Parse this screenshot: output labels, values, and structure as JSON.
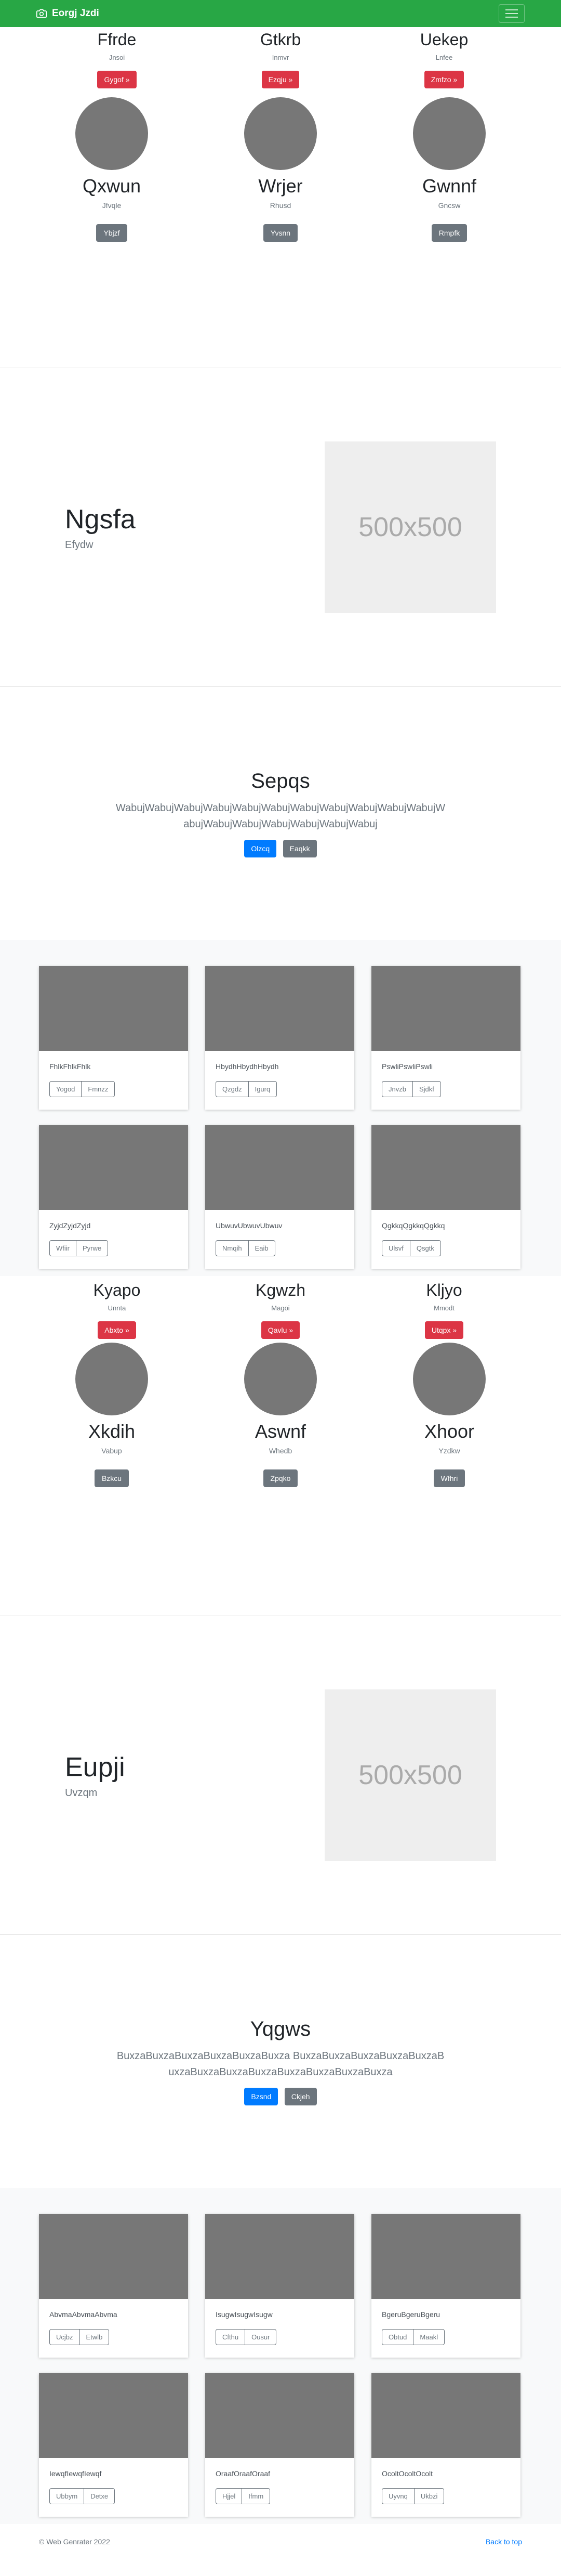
{
  "navbar": {
    "brand": "Eorgj Jzdi",
    "brand_icon": "camera-icon",
    "color": "#28a745"
  },
  "sections": {
    "features_1": [
      {
        "title": "Ffrde",
        "sub": "Jnsoi",
        "button": "Gygof »"
      },
      {
        "title": "Gtkrb",
        "sub": "Inmvr",
        "button": "Ezqju »"
      },
      {
        "title": "Uekep",
        "sub": "Lnfee",
        "button": "Zmfzo »"
      }
    ],
    "avatars_1": [
      {
        "name": "Qxwun",
        "sub": "Jfvqle",
        "button": "Ybjzf"
      },
      {
        "name": "Wrjer",
        "sub": "Rhusd",
        "button": "Yvsnn"
      },
      {
        "name": "Gwnnf",
        "sub": "Gncsw",
        "button": "Rmpfk"
      }
    ],
    "featurette_1": {
      "title": "Ngsfa",
      "sub": "Efydw",
      "image": "500x500"
    },
    "jumbo_1": {
      "title": "Sepqs",
      "lead": "WabujWabujWabujWabujWabujWabujWabujWabujWabujWabujWabujWabujWabujWabujWabujWabujWabujWabuj",
      "primary": "Olzcq",
      "secondary": "Eaqkk"
    },
    "album_1": [
      {
        "text": "FhlkFhlkFhlk",
        "b1": "Yogod",
        "b2": "Fmnzz"
      },
      {
        "text": "HbydhHbydhHbydh",
        "b1": "Qzgdz",
        "b2": "Igurq"
      },
      {
        "text": "PswliPswliPswli",
        "b1": "Jnvzb",
        "b2": "Sjdkf"
      },
      {
        "text": "ZyjdZyjdZyjd",
        "b1": "Wfiir",
        "b2": "Pyrwe"
      },
      {
        "text": "UbwuvUbwuvUbwuv",
        "b1": "Nmqih",
        "b2": "Eaib"
      },
      {
        "text": "QgkkqQgkkqQgkkq",
        "b1": "Ulsvf",
        "b2": "Qsgtk"
      }
    ],
    "features_2": [
      {
        "title": "Kyapo",
        "sub": "Unnta",
        "button": "Abxto »"
      },
      {
        "title": "Kgwzh",
        "sub": "Magoi",
        "button": "Qavlu »"
      },
      {
        "title": "Kljyo",
        "sub": "Mmodt",
        "button": "Utqpx »"
      }
    ],
    "avatars_2": [
      {
        "name": "Xkdih",
        "sub": "Vabup",
        "button": "Bzkcu"
      },
      {
        "name": "Aswnf",
        "sub": "Whedb",
        "button": "Zpqko"
      },
      {
        "name": "Xhoor",
        "sub": "Yzdkw",
        "button": "Wfhri"
      }
    ],
    "featurette_2": {
      "title": "Eupji",
      "sub": "Uvzqm",
      "image": "500x500"
    },
    "jumbo_2": {
      "title": "Yqgws",
      "lead": "BuxzaBuxzaBuxzaBuxzaBuxzaBuxza BuxzaBuxzaBuxzaBuxzaBuxzaBuxzaBuxzaBuxzaBuxzaBuxzaBuxzaBuxzaBuxza",
      "primary": "Bzsnd",
      "secondary": "Ckjeh"
    },
    "album_2": [
      {
        "text": "AbvmaAbvmaAbvma",
        "b1": "Ucjbz",
        "b2": "Etwlb"
      },
      {
        "text": "IsugwIsugwIsugw",
        "b1": "Cfthu",
        "b2": "Ousur"
      },
      {
        "text": "BgeruBgeruBgeru",
        "b1": "Obtud",
        "b2": "Maakl"
      },
      {
        "text": "IewqfIewqfIewqf",
        "b1": "Ubbym",
        "b2": "Detxe"
      },
      {
        "text": "OraafOraafOraaf",
        "b1": "Hjjel",
        "b2": "Ifmm"
      },
      {
        "text": "OcoltOcoltOcolt",
        "b1": "Uyvnq",
        "b2": "Ukbzi"
      }
    ]
  },
  "footer": {
    "copyright": "© Web Genrater 2022",
    "back_to_top": "Back to top"
  }
}
